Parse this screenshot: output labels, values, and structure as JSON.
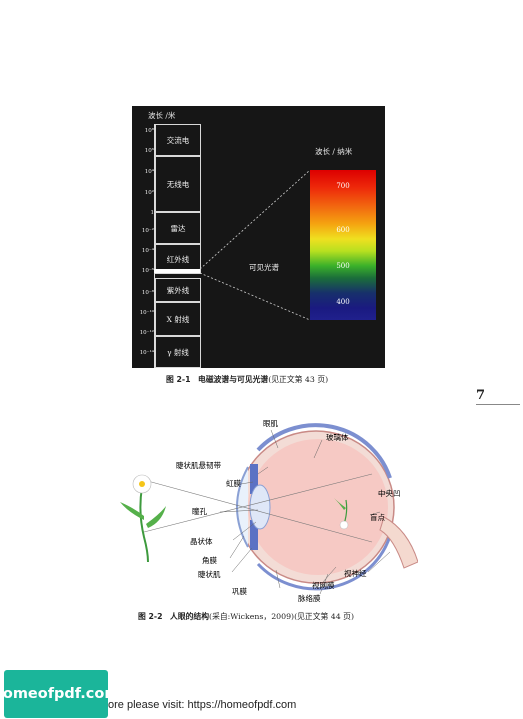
{
  "figure1": {
    "wavelength_m_label": "波长 /米",
    "wavelength_nm_label": "波长 / 纳米",
    "ticks": [
      "10⁸",
      "10⁶",
      "10⁴",
      "10²",
      "1",
      "10⁻²",
      "10⁻⁴",
      "10⁻⁶",
      "10⁻⁸",
      "10⁻¹⁰",
      "10⁻¹²",
      "10⁻¹⁴"
    ],
    "bands": [
      "交流电",
      "无线电",
      "雷达",
      "红外线",
      "紫外线",
      "X 射线",
      "γ 射线"
    ],
    "visible_label": "可见光谱",
    "spectrum_ticks": [
      "700",
      "600",
      "500",
      "400"
    ],
    "caption_number": "图 2-1",
    "caption_title": "电磁波谱与可见光谱",
    "caption_note": "(见正文第 43 页)"
  },
  "page_number": "7",
  "figure2": {
    "labels": {
      "eye_muscle": "眼肌",
      "vitreous": "玻璃体",
      "zonule": "睫状肌悬韧带",
      "iris": "虹膜",
      "fovea": "中央凹",
      "blind_spot": "盲点",
      "pupil": "瞳孔",
      "lens": "晶状体",
      "cornea": "角膜",
      "ciliary_muscle": "睫状肌",
      "optic_nerve": "视神经",
      "retina": "视网膜",
      "sclera": "巩膜",
      "choroid": "脉络膜"
    },
    "caption_number": "图 2-2",
    "caption_title": "人眼的结构",
    "caption_note": "(采自:Wickens，2009)(见正文第 44 页)"
  },
  "footer": {
    "logo_text": "homeofpdf.com",
    "link_text": "ore please visit: https://homeofpdf.com"
  },
  "colors": {
    "figure1_bg": "#161616",
    "eye_pink": "#f6c9c4",
    "eye_blue": "#7c8fd0",
    "logo_green": "#1bb59a"
  }
}
